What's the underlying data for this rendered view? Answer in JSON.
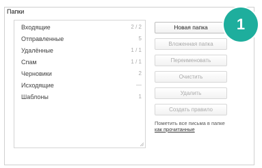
{
  "section_title": "Папки",
  "folders": [
    {
      "name": "Входящие",
      "count": "2 / 2"
    },
    {
      "name": "Отправленные",
      "count": "5"
    },
    {
      "name": "Удалённые",
      "count": "1 / 1"
    },
    {
      "name": "Спам",
      "count": "1 / 1"
    },
    {
      "name": "Черновики",
      "count": "2"
    },
    {
      "name": "Исходящие",
      "count": "—"
    },
    {
      "name": "Шаблоны",
      "count": "1"
    }
  ],
  "buttons": {
    "new_folder": "Новая папка",
    "subfolder": "Вложенная папка",
    "rename": "Переименовать",
    "clear": "Очистить",
    "delete": "Удалить",
    "create_rule": "Создать правило"
  },
  "mark_read_note": {
    "text": "Пометить все письма в папке",
    "link": "как прочитанные"
  },
  "step_badge": "1",
  "colors": {
    "badge": "#1eae9d",
    "border": "#cfcfcf",
    "disabled_text": "#a9a9a9"
  }
}
